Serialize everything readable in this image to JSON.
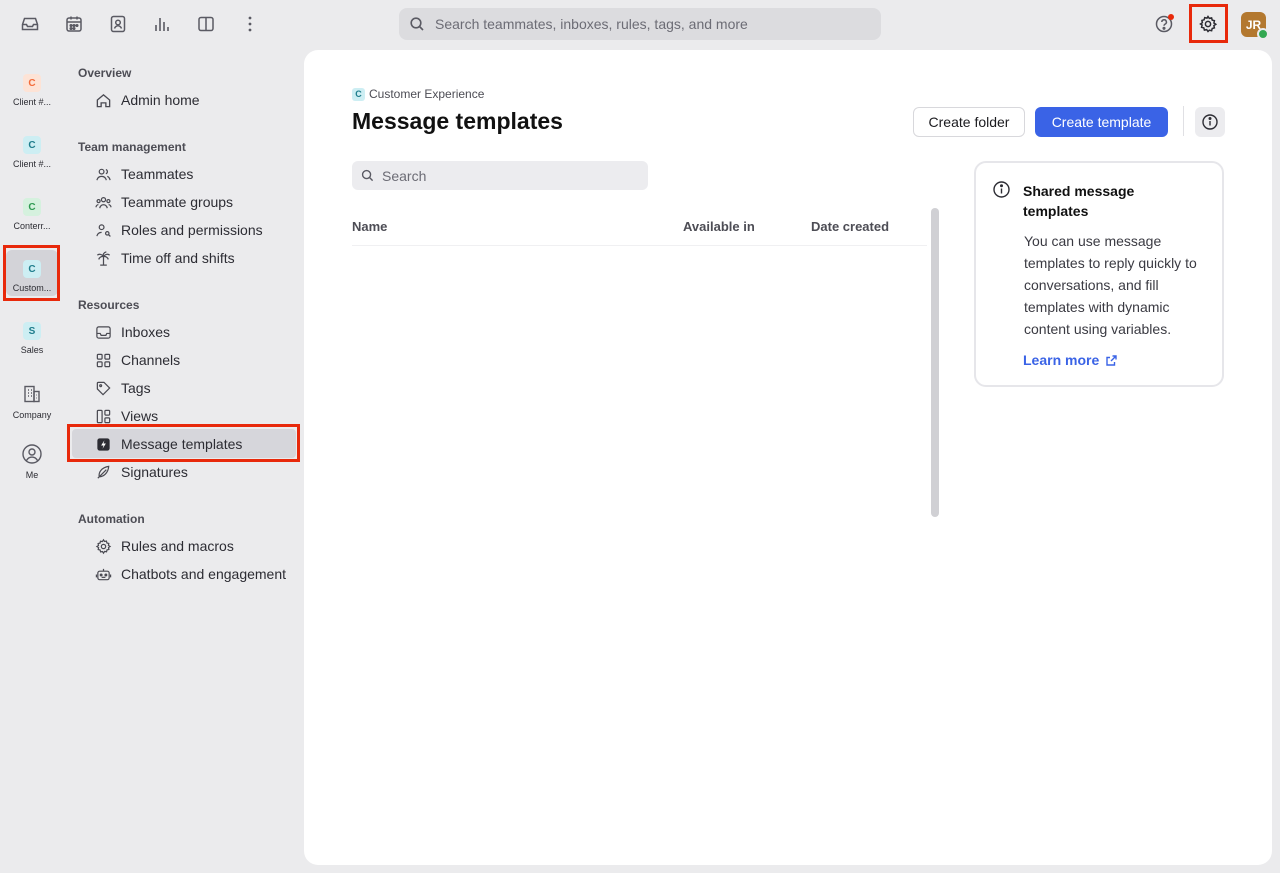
{
  "topbar": {
    "search_placeholder": "Search teammates, inboxes, rules, tags, and more",
    "avatar_initials": "JR",
    "icons": [
      "inbox-icon",
      "calendar-icon",
      "contacts-icon",
      "analytics-icon",
      "split-view-icon",
      "more-icon",
      "help-icon",
      "settings-icon"
    ]
  },
  "rail": {
    "items": [
      {
        "badge": "C",
        "label": "Client #...",
        "color": "#f36b3a",
        "bg": "#fde3d6"
      },
      {
        "badge": "C",
        "label": "Client #...",
        "color": "#1f7d8c",
        "bg": "#cdeef3"
      },
      {
        "badge": "C",
        "label": "Conterr...",
        "color": "#2f9a52",
        "bg": "#d5f1de"
      },
      {
        "badge": "C",
        "label": "Custom...",
        "color": "#1f7d8c",
        "bg": "#cdeef3"
      },
      {
        "badge": "S",
        "label": "Sales",
        "color": "#1f7d8c",
        "bg": "#cdeef3"
      }
    ],
    "company_label": "Company",
    "me_label": "Me"
  },
  "nav": {
    "overview": "Overview",
    "admin_home": "Admin home",
    "team_management": "Team management",
    "teammates": "Teammates",
    "teammate_groups": "Teammate groups",
    "roles": "Roles and permissions",
    "time_off": "Time off and shifts",
    "resources": "Resources",
    "inboxes": "Inboxes",
    "channels": "Channels",
    "tags": "Tags",
    "views": "Views",
    "message_templates": "Message templates",
    "signatures": "Signatures",
    "automation": "Automation",
    "rules": "Rules and macros",
    "chatbots": "Chatbots and engagement"
  },
  "main": {
    "breadcrumb_badge": "C",
    "breadcrumb": "Customer Experience",
    "title": "Message templates",
    "create_folder": "Create folder",
    "create_template": "Create template",
    "search_placeholder": "Search",
    "columns": {
      "name": "Name",
      "available_in": "Available in",
      "date_created": "Date created"
    }
  },
  "info": {
    "title": "Shared message templates",
    "body": "You can use message templates to reply quickly to conversations, and fill templates with dynamic content using variables.",
    "link": "Learn more"
  },
  "colors": {
    "accent": "#3a63e6",
    "highlight": "#e8290b"
  }
}
